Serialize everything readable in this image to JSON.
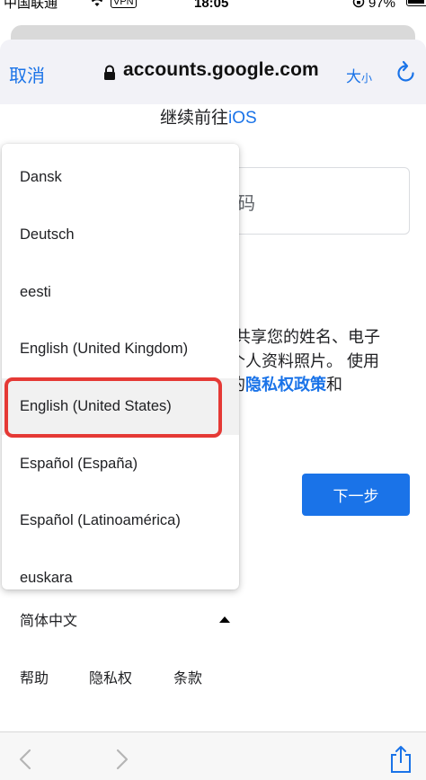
{
  "status_bar": {
    "carrier": "中国联通",
    "vpn": "VPN",
    "time": "18:05",
    "battery": "97%"
  },
  "toolbar": {
    "cancel_label": "取消",
    "url": "accounts.google.com",
    "text_size_big": "大",
    "text_size_small": "小"
  },
  "content": {
    "continue_prefix": "继续前往",
    "continue_app": "iOS",
    "password_placeholder_visible": "码",
    "info_line1": "”共享您的姓名、电子",
    "info_line2": "个人资料照片。 使用",
    "info_line3_prefix": "的",
    "info_line3_link": "隐私权政策",
    "info_line3_suffix": "和",
    "next_button": "下一步"
  },
  "language_select": {
    "current": "简体中文",
    "options": [
      "Dansk",
      "Deutsch",
      "eesti",
      "English (United Kingdom)",
      "English (United States)",
      "Español (España)",
      "Español (Latinoamérica)",
      "euskara"
    ],
    "highlighted": "English (United States)"
  },
  "footer": {
    "help": "帮助",
    "privacy": "隐私权",
    "terms": "条款"
  },
  "colors": {
    "accent": "#1a73e8",
    "highlight": "#e53935"
  }
}
